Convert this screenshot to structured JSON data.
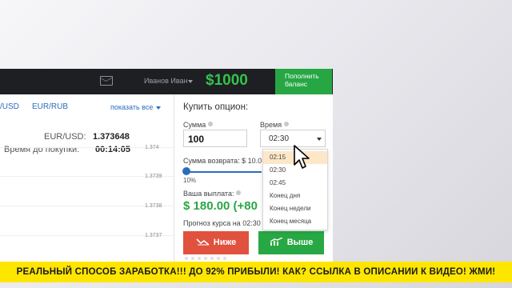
{
  "header": {
    "user_name": "Иванов Иван",
    "balance": "$1000",
    "deposit_label": "Пополнить\nбаланс"
  },
  "asset_tabs": {
    "tabs": [
      "/USD",
      "EUR/RUB"
    ],
    "show_all": "показать все"
  },
  "chart_info": {
    "pair_label": "EUR/USD:",
    "pair_value": "1.373648",
    "time_label": "Время до покупки:",
    "time_value": "00:14:05",
    "ticks": [
      "1.374",
      "1.3739",
      "1.3738",
      "1.3737"
    ]
  },
  "buy_option": {
    "title": "Купить опцион:",
    "amount_label": "Сумма",
    "amount_value": "100",
    "time_label": "Время",
    "time_value": "02:30",
    "return_label": "Сумма возврата: $ 10.0",
    "slider_pct": "10%",
    "slider_level": 0.1,
    "payout_label": "Ваша выплата:",
    "payout_value": "$ 180.00 (+80",
    "forecast_label": "Прогноз курса на 02:30",
    "low_label": "Ниже",
    "high_label": "Выше"
  },
  "time_dropdown": {
    "options": [
      "02:15",
      "02:30",
      "02:45",
      "Конец дня",
      "Конец недели",
      "Конец месяца"
    ],
    "selected_index": 0
  },
  "banner": {
    "text": "РЕАЛЬНЫЙ СПОСОБ ЗАРАБОТКА!!! ДО 92% ПРИБЫЛИ! КАК? ССЫЛКА В ОПИСАНИИ К ВИДЕО! ЖМИ!"
  },
  "colors": {
    "balance": "#35c24a",
    "deposit": "#27a744",
    "low_button": "#e0523e",
    "high_button": "#28a844",
    "banner": "#ffe600"
  }
}
